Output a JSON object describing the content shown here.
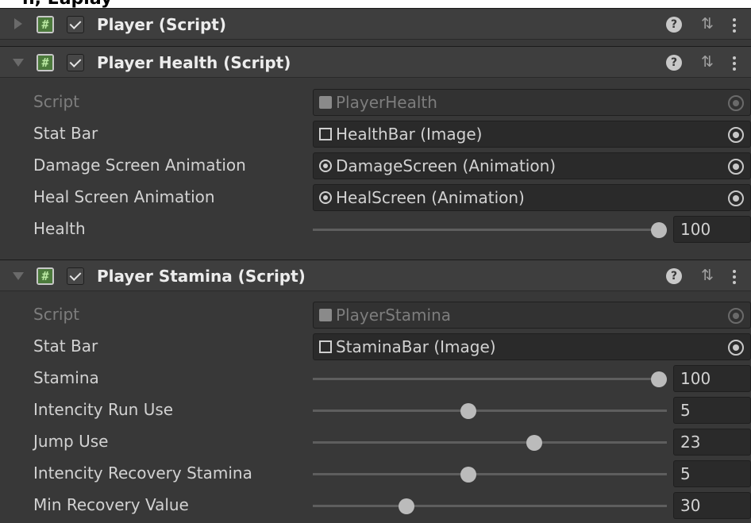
{
  "top_cut_text": "h, Eaplay",
  "components": [
    {
      "title": "Player (Script)",
      "expanded": false
    },
    {
      "title": "Player Health (Script)",
      "expanded": true,
      "fields": [
        {
          "label": "Script",
          "value": "PlayerHealth"
        },
        {
          "label": "Stat Bar",
          "value": "HealthBar (Image)"
        },
        {
          "label": "Damage Screen Animation",
          "value": "DamageScreen (Animation)"
        },
        {
          "label": "Heal Screen Animation",
          "value": "HealScreen (Animation)"
        },
        {
          "label": "Health",
          "value": "100",
          "slider_fraction": 1.0
        }
      ]
    },
    {
      "title": "Player Stamina (Script)",
      "expanded": true,
      "fields": [
        {
          "label": "Script",
          "value": "PlayerStamina"
        },
        {
          "label": "Stat Bar",
          "value": "StaminaBar (Image)"
        },
        {
          "label": "Stamina",
          "value": "100",
          "slider_fraction": 1.0
        },
        {
          "label": "Intencity Run Use",
          "value": "5",
          "slider_fraction": 0.45
        },
        {
          "label": "Jump Use",
          "value": "23",
          "slider_fraction": 0.64
        },
        {
          "label": "Intencity Recovery Stamina",
          "value": "5",
          "slider_fraction": 0.45
        },
        {
          "label": "Min Recovery Value",
          "value": "30",
          "slider_fraction": 0.27
        }
      ]
    }
  ],
  "icons": {
    "help": "?",
    "preset": "⇅"
  },
  "colors": {
    "background": "#383838",
    "header": "#3e3e3e",
    "field": "#2a2a2a"
  }
}
